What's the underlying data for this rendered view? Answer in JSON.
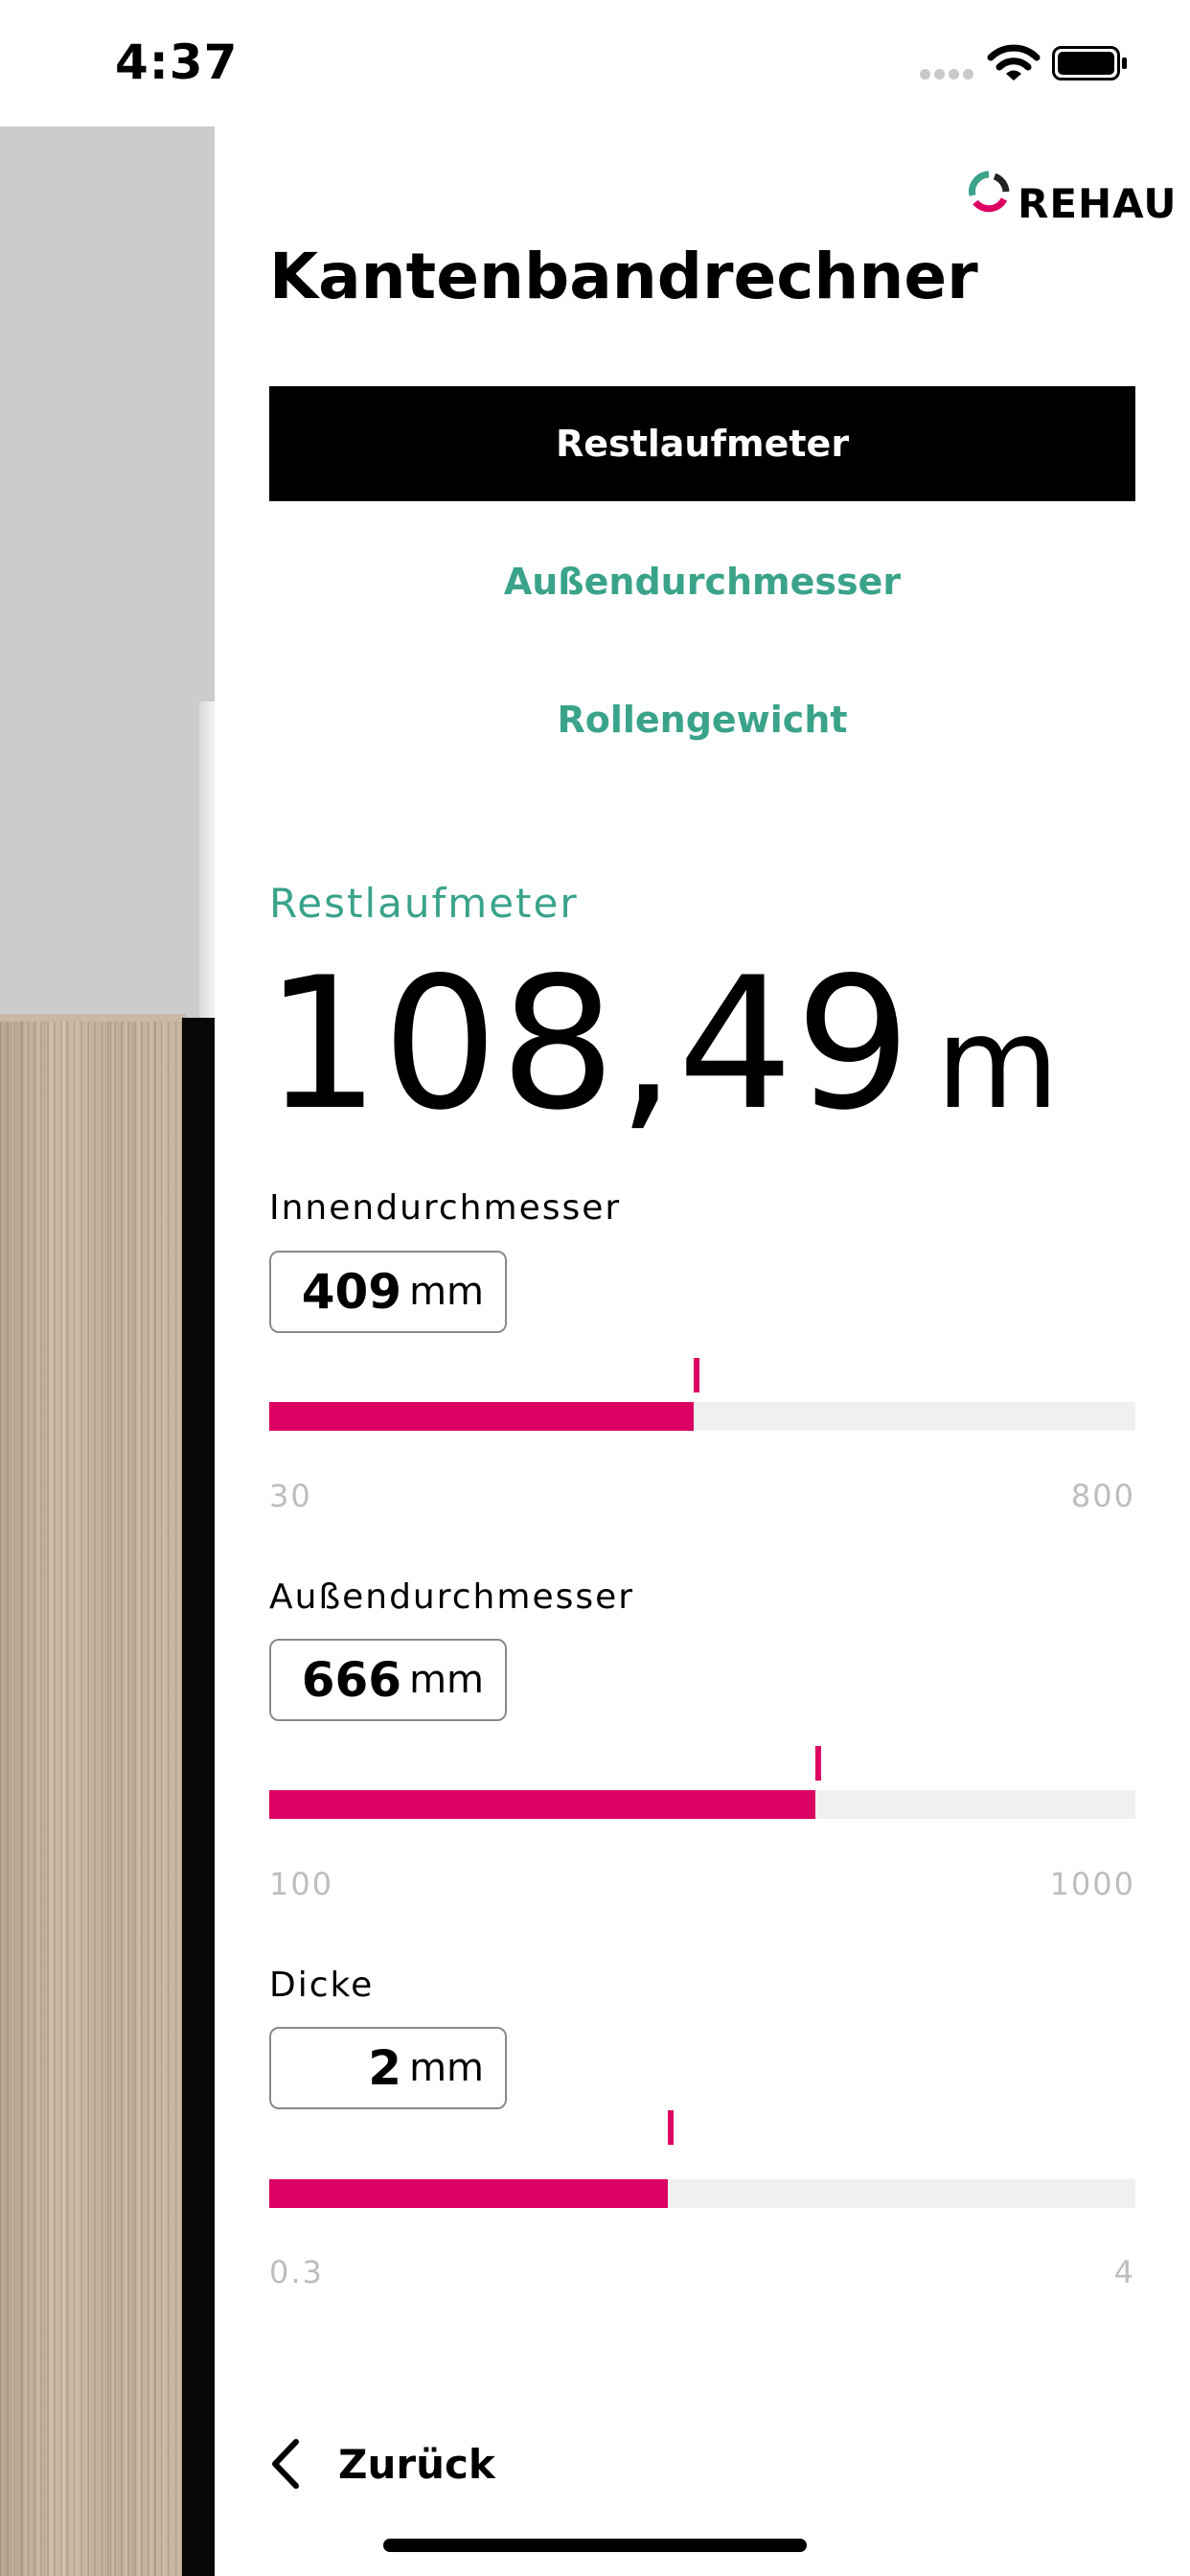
{
  "status_bar": {
    "time": "4:37"
  },
  "brand": {
    "name": "REHAU",
    "accent": "#dc0062",
    "teal": "#3aa38a"
  },
  "header": {
    "title": "Kantenbandrechner"
  },
  "modes": [
    {
      "label": "Restlaufmeter",
      "active": true
    },
    {
      "label": "Außendurchmesser",
      "active": false
    },
    {
      "label": "Rollengewicht",
      "active": false
    }
  ],
  "result": {
    "label": "Restlaufmeter",
    "value": "108,49",
    "unit": "m"
  },
  "fields": [
    {
      "label": "Innendurchmesser",
      "value": "409",
      "unit": "mm",
      "min": "30",
      "max": "800",
      "slider_fraction": 0.49
    },
    {
      "label": "Außendurchmesser",
      "value": "666",
      "unit": "mm",
      "min": "100",
      "max": "1000",
      "slider_fraction": 0.63
    },
    {
      "label": "Dicke",
      "value": "2",
      "unit": "mm",
      "min": "0.3",
      "max": "4",
      "slider_fraction": 0.46
    }
  ],
  "footer": {
    "back_label": "Zurück"
  },
  "icons": [
    "signal-icon",
    "wifi-icon",
    "battery-icon",
    "rehau-logo-icon",
    "chevron-left-icon"
  ]
}
